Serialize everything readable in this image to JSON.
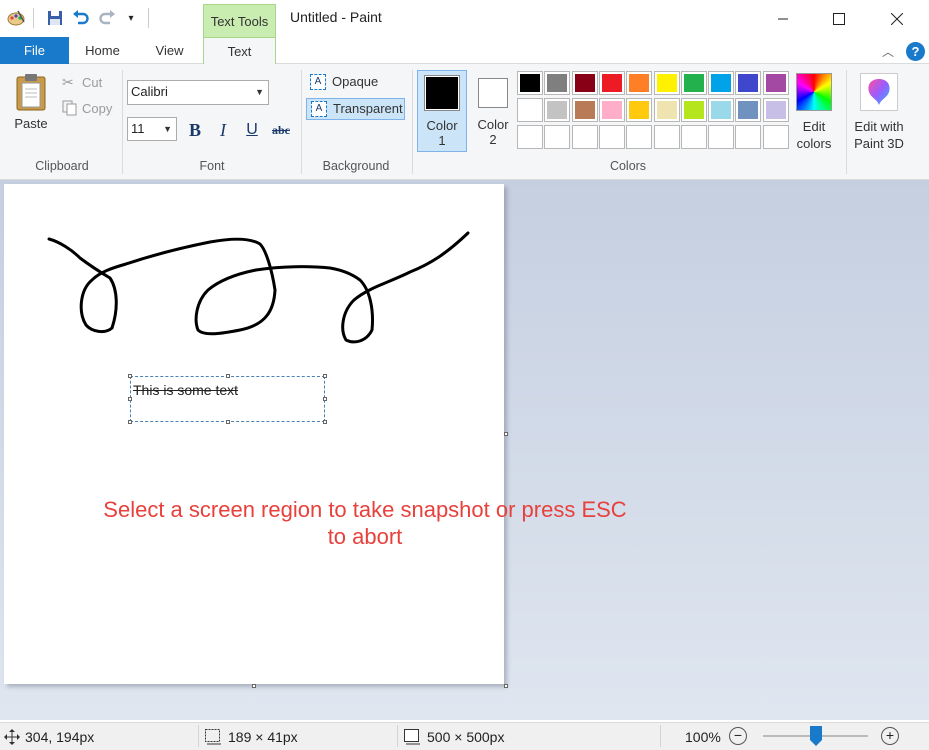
{
  "window": {
    "title": "Untitled - Paint",
    "context_tab": "Text Tools"
  },
  "tabs": {
    "file": "File",
    "home": "Home",
    "view": "View",
    "text": "Text"
  },
  "clipboard": {
    "paste": "Paste",
    "cut": "Cut",
    "copy": "Copy",
    "group": "Clipboard"
  },
  "font": {
    "family": "Calibri",
    "size": "11",
    "bold": "B",
    "italic": "I",
    "underline": "U",
    "strike": "abc",
    "group": "Font"
  },
  "background": {
    "opaque": "Opaque",
    "transparent": "Transparent",
    "group": "Background",
    "selected": "Transparent"
  },
  "colors": {
    "color1_label": "Color",
    "color1_num": "1",
    "color2_label": "Color",
    "color2_num": "2",
    "color1_value": "#000000",
    "color2_value": "#ffffff",
    "edit_line1": "Edit",
    "edit_line2": "colors",
    "group": "Colors",
    "palette_row1": [
      "#000000",
      "#7f7f7f",
      "#880015",
      "#ed1c24",
      "#ff7f27",
      "#fff200",
      "#22b14c",
      "#00a2e8",
      "#3f48cc",
      "#a349a4"
    ],
    "palette_row2": [
      "#ffffff",
      "#c3c3c3",
      "#b97a57",
      "#ffaec9",
      "#ffc90e",
      "#efe4b0",
      "#b5e61d",
      "#99d9ea",
      "#7092be",
      "#c8bfe7"
    ],
    "palette_row3": [
      "#ffffff",
      "#ffffff",
      "#ffffff",
      "#ffffff",
      "#ffffff",
      "#ffffff",
      "#ffffff",
      "#ffffff",
      "#ffffff",
      "#ffffff"
    ]
  },
  "paint3d": {
    "line1": "Edit with",
    "line2": "Paint 3D"
  },
  "canvas": {
    "text": "This is some text"
  },
  "overlay": {
    "line1": "Select a screen region to take snapshot or press ESC",
    "line2": "to abort"
  },
  "status": {
    "cursor": "304, 194px",
    "selection": "189 × 41px",
    "canvas_size": "500 × 500px",
    "zoom": "100%",
    "zoom_level_pct": 100
  },
  "accent": {
    "file_tab": "#1979ca",
    "context_green": "#c9ecb0",
    "overlay_red": "#e8413c"
  }
}
